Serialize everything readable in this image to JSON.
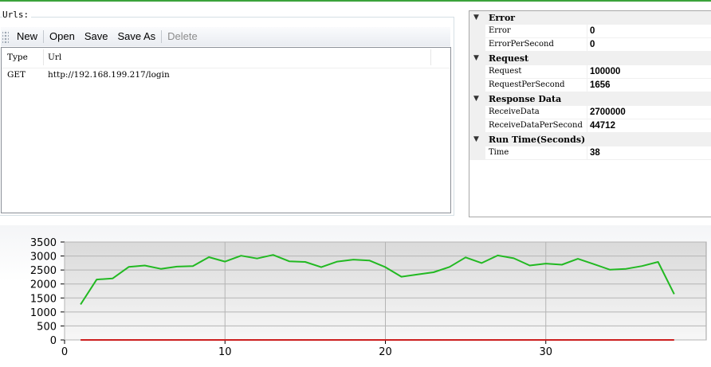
{
  "urls": {
    "legend": "Urls:",
    "toolbar": {
      "new": "New",
      "open": "Open",
      "save": "Save",
      "save_as": "Save As",
      "delete": "Delete"
    },
    "columns": {
      "type": "Type",
      "url": "Url"
    },
    "rows": [
      {
        "type": "GET",
        "url": "http://192.168.199.217/login"
      }
    ]
  },
  "properties": {
    "error": {
      "label": "Error",
      "rows": [
        {
          "name": "Error",
          "value": "0"
        },
        {
          "name": "ErrorPerSecond",
          "value": "0"
        }
      ]
    },
    "request": {
      "label": "Request",
      "rows": [
        {
          "name": "Request",
          "value": "100000"
        },
        {
          "name": "RequestPerSecond",
          "value": "1656"
        }
      ]
    },
    "response": {
      "label": "Response Data",
      "rows": [
        {
          "name": "ReceiveData",
          "value": "2700000"
        },
        {
          "name": "ReceiveDataPerSecond",
          "value": "44712"
        }
      ]
    },
    "runtime": {
      "label": "Run Time(Seconds)",
      "rows": [
        {
          "name": "Time",
          "value": "38"
        }
      ]
    }
  },
  "colors": {
    "series_requests": "#22b922",
    "series_errors": "#cc1f1f",
    "accent_top": "#3aa33a"
  },
  "chart_data": {
    "type": "line",
    "xlim": [
      0,
      40
    ],
    "ylim": [
      0,
      3500
    ],
    "xticks": [
      0,
      10,
      20,
      30
    ],
    "yticks": [
      0,
      500,
      1000,
      1500,
      2000,
      2500,
      3000,
      3500
    ],
    "grid": true,
    "series": [
      {
        "x": [
          1,
          2,
          3,
          4,
          5,
          6,
          7,
          8,
          9,
          10,
          11,
          12,
          13,
          14,
          15,
          16,
          17,
          18,
          19,
          20,
          21,
          22,
          23,
          24,
          25,
          26,
          27,
          28,
          29,
          30,
          31,
          32,
          33,
          34,
          35,
          36,
          37,
          38
        ],
        "values": [
          1270,
          2160,
          2200,
          2610,
          2660,
          2540,
          2620,
          2640,
          2960,
          2800,
          3010,
          2910,
          3040,
          2810,
          2790,
          2600,
          2800,
          2870,
          2840,
          2600,
          2260,
          2340,
          2420,
          2610,
          2950,
          2750,
          3020,
          2920,
          2660,
          2730,
          2690,
          2900,
          2710,
          2510,
          2540,
          2640,
          2790,
          1640
        ],
        "color": "#22b922"
      },
      {
        "x": [
          1,
          38
        ],
        "values": [
          0,
          0
        ],
        "color": "#cc1f1f"
      }
    ]
  }
}
